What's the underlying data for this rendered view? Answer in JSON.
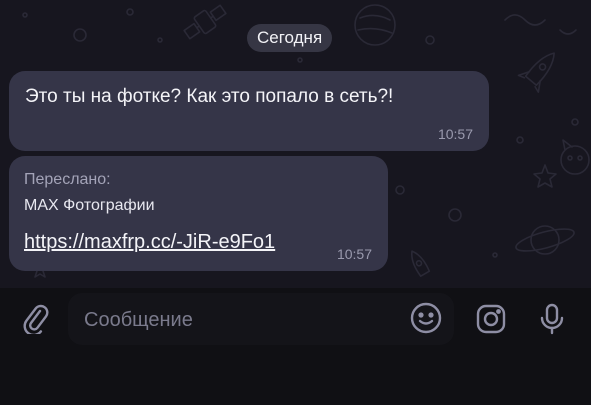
{
  "chat": {
    "date_chip": "Сегодня",
    "messages": [
      {
        "text": "Это ты на фотке? Как это попало в сеть?!",
        "time": "10:57"
      },
      {
        "forwarded_label": "Переслано:",
        "forwarded_source": "MAX Фотографии",
        "link": "https://maxfrp.cc/-JiR-e9Fo1",
        "time": "10:57"
      }
    ]
  },
  "composer": {
    "placeholder": "Сообщение",
    "value": ""
  },
  "icons": {
    "attach": "paperclip-icon",
    "emoji": "smiley-icon",
    "camera": "camera-icon",
    "microphone": "microphone-icon"
  },
  "colors": {
    "chat_background": "#17161f",
    "bubble": "#353548",
    "input_bar": "#101014",
    "icon": "#8e8ea4"
  }
}
